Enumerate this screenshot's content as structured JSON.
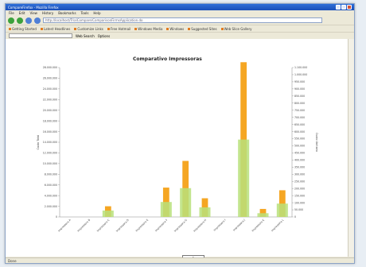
{
  "window": {
    "title": "CompareFirefox - Mozilla Firefox"
  },
  "menu": [
    "File",
    "Edit",
    "View",
    "History",
    "Bookmarks",
    "Tools",
    "Help"
  ],
  "address": {
    "url": "http://localhost/TrialCompare/ComparisonFirmsApplication.do"
  },
  "bookmarks": [
    "Getting Started",
    "Latest Headlines",
    "Customize Links",
    "Free Hotmail",
    "Windows Media",
    "Windows",
    "Suggested Sites",
    "Web Slice Gallery"
  ],
  "toolbar2": {
    "search_placeholder": "",
    "items": [
      "Web Search",
      "Options"
    ]
  },
  "status": {
    "text": "Done"
  },
  "pager": {
    "label": "1"
  },
  "chart_data": {
    "type": "bar",
    "title": "Comparativo Impressoras",
    "categories": [
      "Impressora A",
      "Impressora B",
      "Impressora C",
      "Impressora D",
      "Impressora E",
      "Impressora F",
      "Impressora G",
      "Impressora H",
      "Impressora I",
      "Impressora J",
      "Impressora K",
      "Impressora L"
    ],
    "series": [
      {
        "name": "Total",
        "color": "#f5a623",
        "values": [
          0,
          0,
          2000000,
          0,
          0,
          5500000,
          10500000,
          3500000,
          0,
          29000000,
          1500000,
          5000000
        ]
      },
      {
        "name": "Unitario",
        "color": "#b8e07a",
        "values": [
          0,
          0,
          1200000,
          0,
          0,
          2800000,
          5400000,
          1800000,
          0,
          14500000,
          700000,
          2500000
        ]
      }
    ],
    "ylim": [
      0,
      28000000
    ],
    "y_ticks": [
      "28.000.000",
      "26.000.000",
      "24.000.000",
      "22.000.000",
      "20.000.000",
      "18.000.000",
      "16.000.000",
      "14.000.000",
      "12.000.000",
      "10.000.000",
      "8.000.000",
      "6.000.000",
      "4.000.000",
      "2.000.000",
      "0"
    ],
    "y2_ticks": [
      "1.100.000",
      "1.000.000",
      "950.000",
      "900.000",
      "850.000",
      "800.000",
      "750.000",
      "700.000",
      "650.000",
      "600.000",
      "550.000",
      "500.000",
      "450.000",
      "400.000",
      "350.000",
      "300.000",
      "250.000",
      "200.000",
      "150.000",
      "100.000",
      "50.000",
      "0"
    ],
    "ylabel": "Custo Total",
    "y2label": "Custo Unitario"
  }
}
